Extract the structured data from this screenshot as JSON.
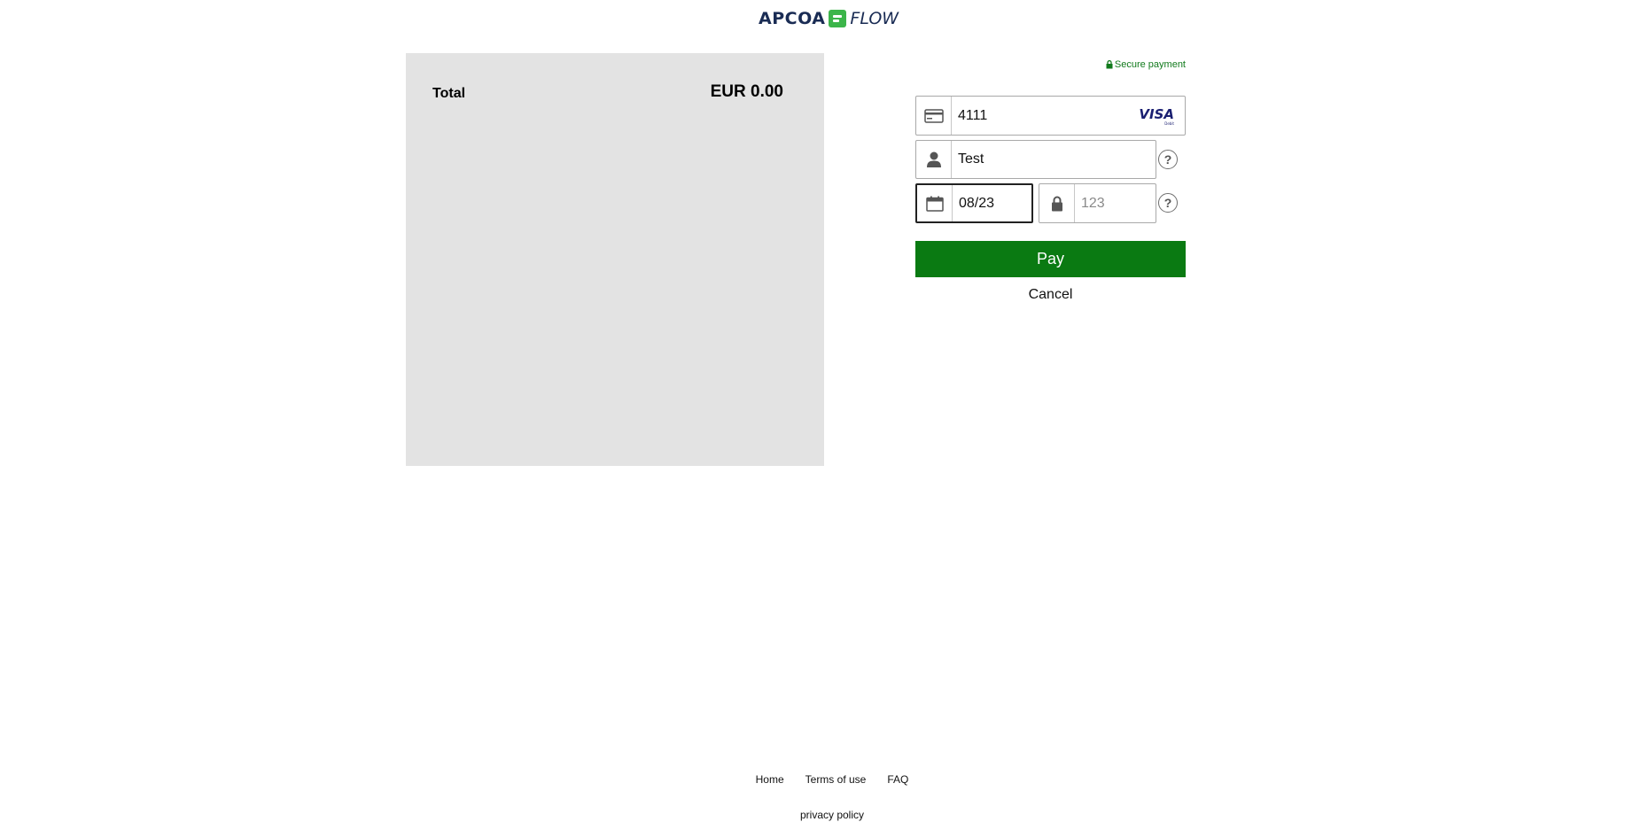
{
  "header": {
    "brand_name": "APCOA",
    "brand_suffix": "FLOW"
  },
  "summary": {
    "total_label": "Total",
    "total_value": "EUR 0.00"
  },
  "payment": {
    "secure_label": "Secure payment",
    "card_number": "4111",
    "card_brand": "VISA",
    "card_brand_sub": "Debit",
    "cardholder_name": "Test",
    "expiry": "08/23",
    "cvc_placeholder": "123",
    "pay_label": "Pay",
    "cancel_label": "Cancel",
    "help_symbol": "?"
  },
  "footer": {
    "links": [
      "Home",
      "Terms of use",
      "FAQ"
    ],
    "privacy_label": "privacy policy"
  },
  "colors": {
    "accent_green": "#0a7a12",
    "brand_navy": "#1a2c54",
    "brand_green": "#3cb54a",
    "panel_gray": "#e3e3e3"
  }
}
